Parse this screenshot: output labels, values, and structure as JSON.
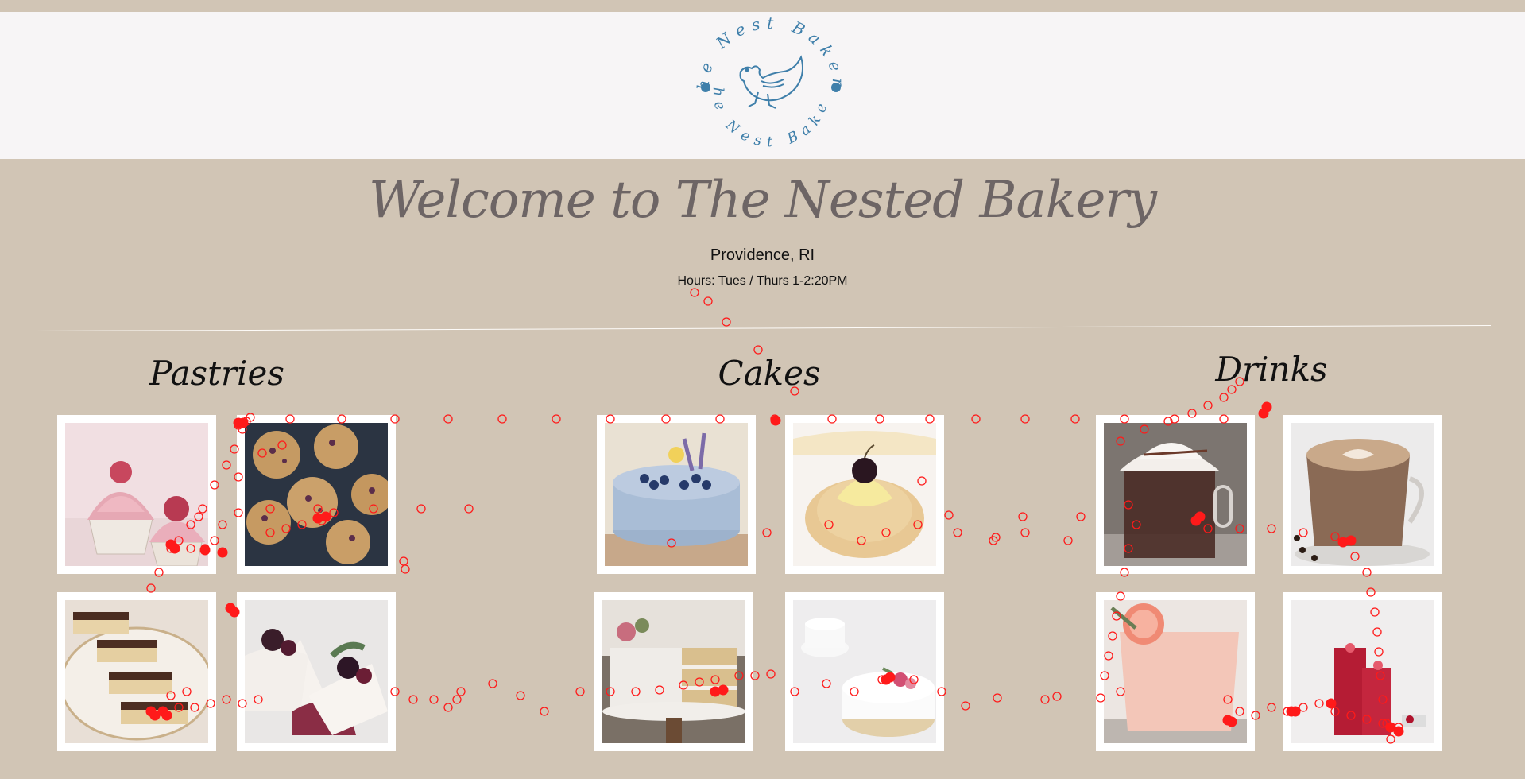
{
  "colors": {
    "page_background": "#d1c5b5",
    "header_background": "#f7f5f6",
    "logo_blue": "#3f7faa",
    "title_grey": "#6d6565",
    "tracker_red": "#ff1a1a"
  },
  "logo": {
    "top_text": "The Nest Bakery",
    "bottom_text": "The Nest Bakery",
    "icon": "hen-icon"
  },
  "hero": {
    "title": "Welcome to The Nested Bakery",
    "location": "Providence, RI",
    "hours": "Hours: Tues / Thurs 1-2:20PM"
  },
  "categories": [
    {
      "title": "Pastries",
      "items": [
        {
          "icon": "raspberry-cupcake-image"
        },
        {
          "icon": "blueberry-muffins-image"
        },
        {
          "icon": "napoleon-pastry-image"
        },
        {
          "icon": "berry-cheesecake-image"
        }
      ]
    },
    {
      "title": "Cakes",
      "items": [
        {
          "icon": "lavender-blueberry-cake-image"
        },
        {
          "icon": "cream-puff-cherry-image"
        },
        {
          "icon": "naked-layer-cake-image"
        },
        {
          "icon": "white-floral-cake-image"
        }
      ]
    },
    {
      "title": "Drinks",
      "items": [
        {
          "icon": "hot-chocolate-image"
        },
        {
          "icon": "latte-image"
        },
        {
          "icon": "grapefruit-cocktail-image"
        },
        {
          "icon": "red-berry-drink-image"
        }
      ]
    }
  ]
}
